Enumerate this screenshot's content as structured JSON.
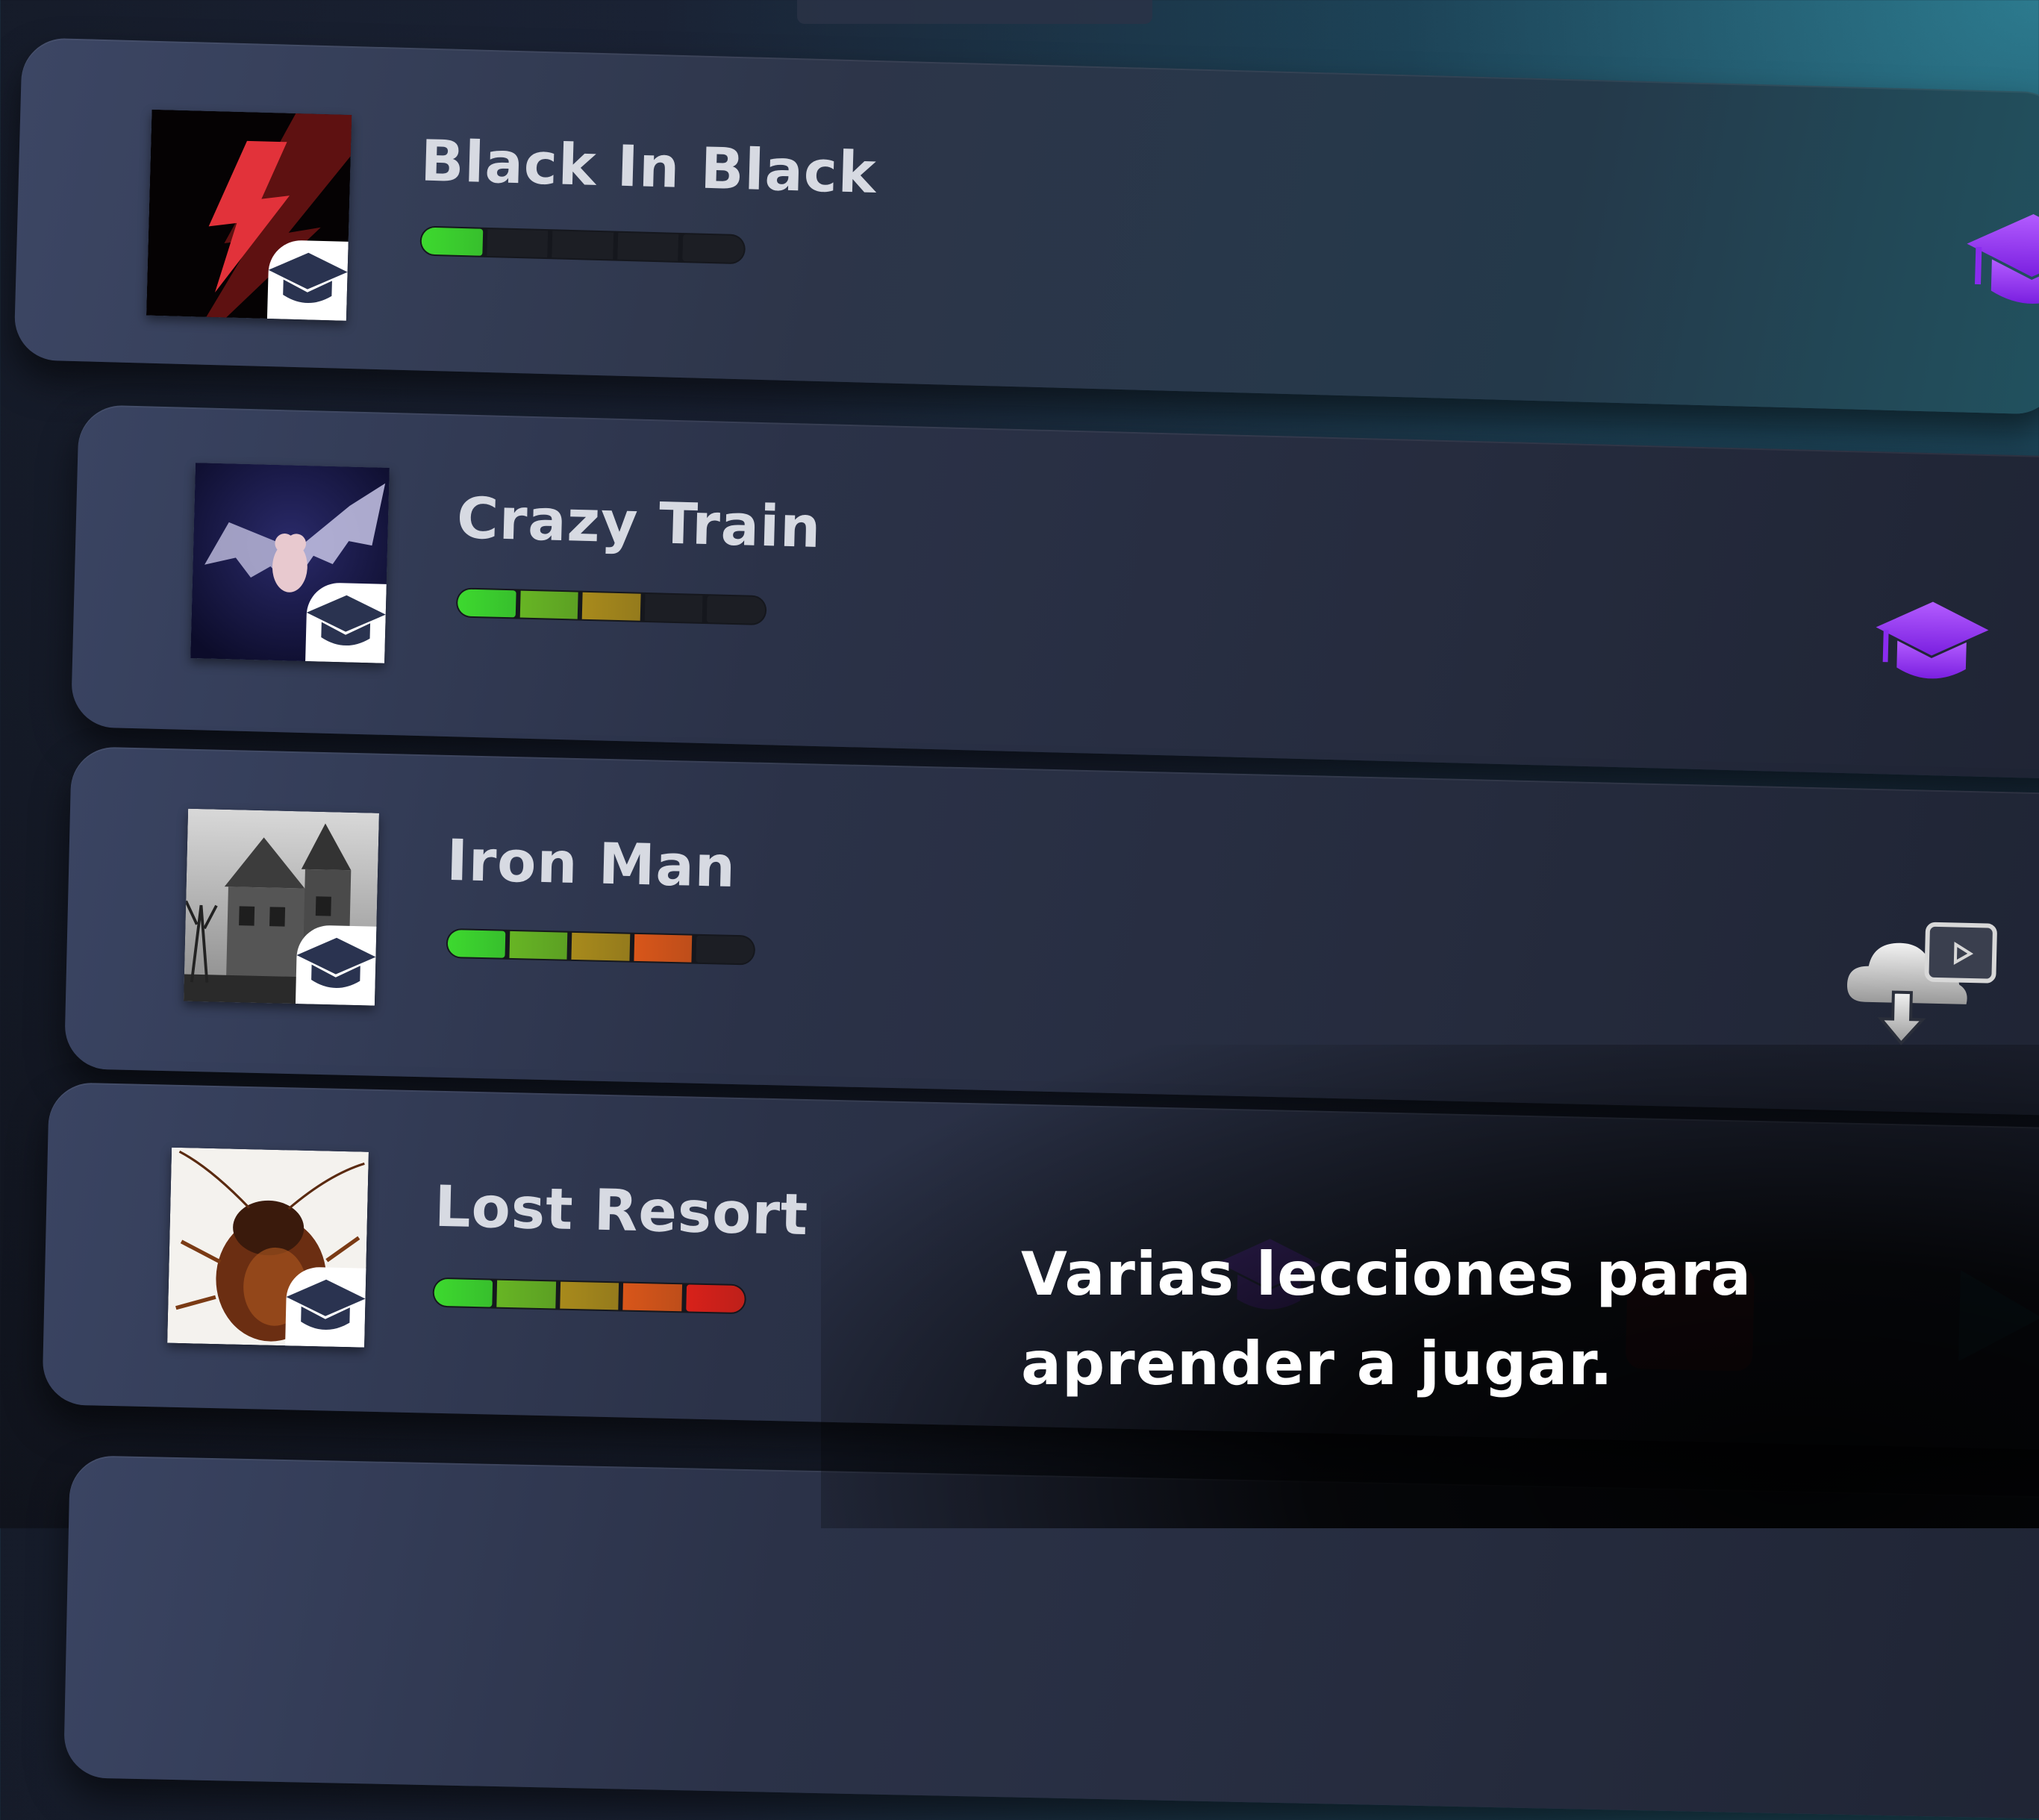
{
  "songs": [
    {
      "title": "Black In Black",
      "progress_segments": 1,
      "total_segments": 5,
      "action_icon": "graduation-cap-icon",
      "thumb": "lightning"
    },
    {
      "title": "Crazy Train",
      "progress_segments": 3,
      "total_segments": 5,
      "action_icon": "graduation-cap-icon",
      "thumb": "bat"
    },
    {
      "title": "Iron Man",
      "progress_segments": 4,
      "total_segments": 5,
      "action_icon": "cloud-download-video-icon",
      "thumb": "haunted-house"
    },
    {
      "title": "Lost Resort",
      "progress_segments": 5,
      "total_segments": 5,
      "action_icon": "graduation-cap-icon",
      "thumb": "cockroach"
    }
  ],
  "caption": {
    "line1": "Varias lecciones para",
    "line2": "aprender a jugar."
  },
  "colors": {
    "segment_colors": [
      "#3dd92f",
      "#67b524",
      "#a88a1c",
      "#d8561a",
      "#d8211a"
    ],
    "empty_segment": "#1c1e24",
    "cap_purple": "#9b3cf5",
    "badge_bg": "#ffffff",
    "badge_icon": "#2a3350"
  }
}
